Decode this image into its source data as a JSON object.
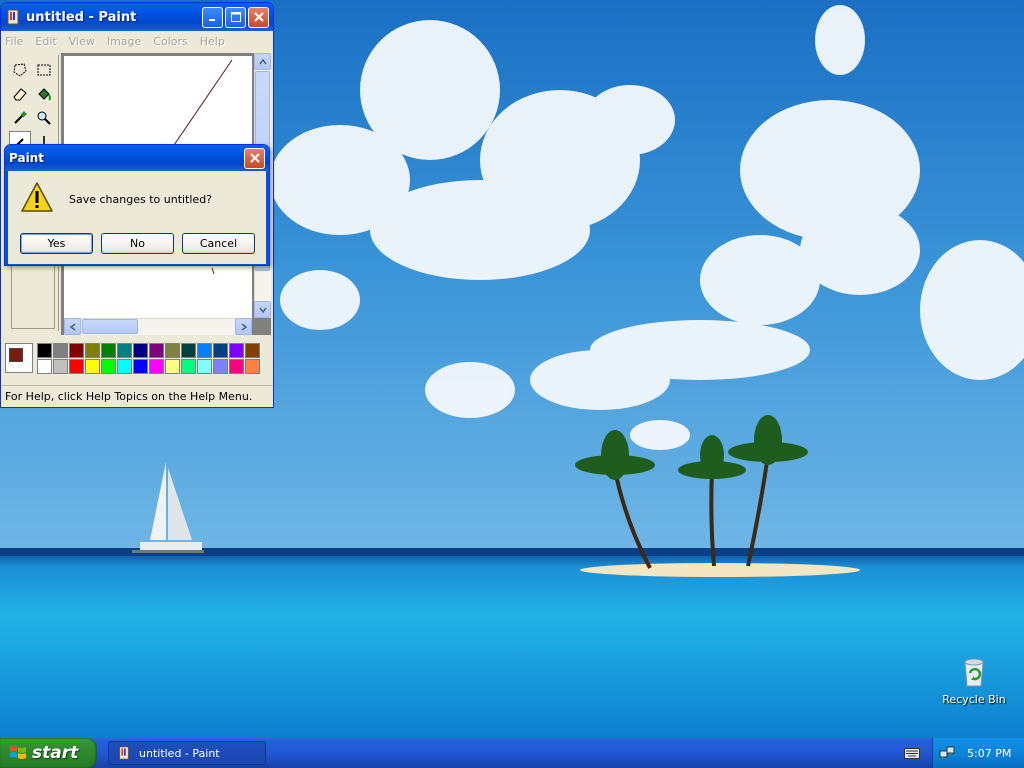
{
  "paint_window": {
    "title": "untitled - Paint",
    "menu": [
      "File",
      "Edit",
      "View",
      "Image",
      "Colors",
      "Help"
    ],
    "status_text": "For Help, click Help Topics on the Help Menu.",
    "current_colors": {
      "foreground": "#7b1b12",
      "background": "#ffffff"
    },
    "palette": [
      [
        "#000000",
        "#808080",
        "#800000",
        "#808000",
        "#008000",
        "#008080",
        "#000080",
        "#800080",
        "#808040",
        "#004040",
        "#0080ff",
        "#004080",
        "#8000ff",
        "#804000"
      ],
      [
        "#ffffff",
        "#c0c0c0",
        "#ff0000",
        "#ffff00",
        "#00ff00",
        "#00ffff",
        "#0000ff",
        "#ff00ff",
        "#ffff80",
        "#00ff80",
        "#80ffff",
        "#8080ff",
        "#ff0080",
        "#ff8040"
      ]
    ]
  },
  "dialog": {
    "title": "Paint",
    "message": "Save changes to untitled?",
    "buttons": {
      "yes": "Yes",
      "no": "No",
      "cancel": "Cancel"
    }
  },
  "desktop": {
    "recycle_bin_label": "Recycle Bin"
  },
  "taskbar": {
    "start_label": "start",
    "task_label": "untitled - Paint",
    "clock": "5:07 PM"
  }
}
